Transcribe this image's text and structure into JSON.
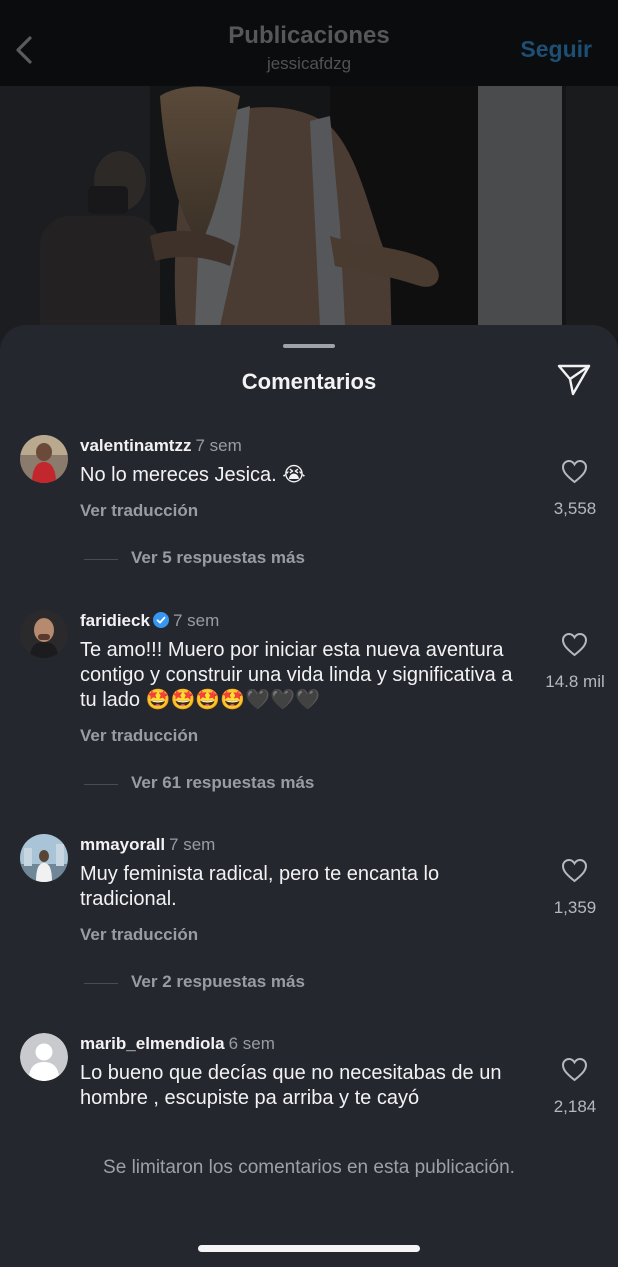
{
  "header": {
    "title": "Publicaciones",
    "subtitle": "jessicafdzg",
    "follow_label": "Seguir",
    "back_icon": "chevron-left-icon"
  },
  "sheet": {
    "title": "Comentarios",
    "share_icon": "paper-plane-icon"
  },
  "comments": [
    {
      "username": "valentinamtzz",
      "time": "7 sem",
      "text": "No lo mereces Jesica. 😭",
      "translate_label": "Ver traducción",
      "replies_label": "Ver 5 respuestas más",
      "likes": "3,558"
    },
    {
      "username": "faridieck",
      "verified": true,
      "time": "7 sem",
      "text": "Te amo!!! Muero por iniciar esta nueva aventura contigo y construir una vida linda y significativa a tu lado 🤩🤩🤩🤩🖤🖤🖤",
      "translate_label": "Ver traducción",
      "replies_label": "Ver 61 respuestas más",
      "likes": "14.8 mil"
    },
    {
      "username": "mmayorall",
      "time": "7 sem",
      "text": "Muy feminista radical, pero te encanta lo tradicional.",
      "translate_label": "Ver traducción",
      "replies_label": "Ver 2 respuestas más",
      "likes": "1,359"
    },
    {
      "username": "marib_elmendiola",
      "time": "6 sem",
      "text": "Lo bueno que decías que no necesitabas de un hombre , escupiste pa arriba y te cayó",
      "likes": "2,184"
    }
  ],
  "footer": {
    "limited_note": "Se limitaron los comentarios en esta publicación."
  },
  "colors": {
    "sheet_background": "#25272e",
    "header_background": "#0b0c0e",
    "follow_blue": "#1d4e74",
    "verified_blue": "#3797f0"
  }
}
